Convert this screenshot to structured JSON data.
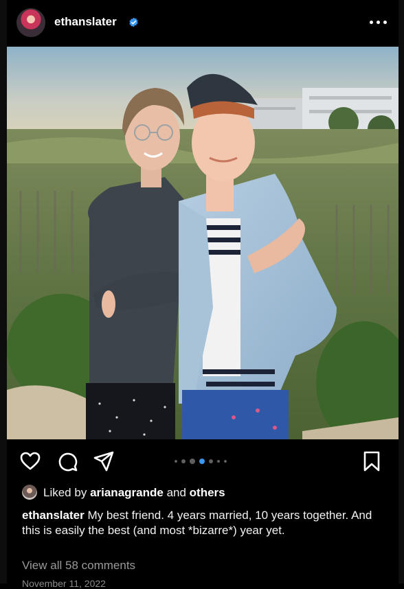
{
  "post": {
    "username": "ethanslater",
    "verified": true,
    "icons": {
      "more": "more-horizontal-icon",
      "like": "heart-icon",
      "comment": "comment-icon",
      "share": "send-icon",
      "save": "bookmark-icon"
    },
    "carousel": {
      "total_dots": 7,
      "active_index": 3,
      "accent": "#3897f0"
    },
    "liked_by": {
      "prefix": "Liked by",
      "user": "arianagrande",
      "joiner": "and",
      "others": "others"
    },
    "caption": {
      "username": "ethanslater",
      "text": "My best friend. 4 years married, 10 years together. And this is easily the best (and most *bizarre*) year yet."
    },
    "comments_link": "View all 58 comments",
    "date": "November 11, 2022"
  },
  "colors": {
    "background": "#000000",
    "text": "#f5f5f5",
    "muted": "#9a9a9a",
    "verified": "#3897f0"
  }
}
